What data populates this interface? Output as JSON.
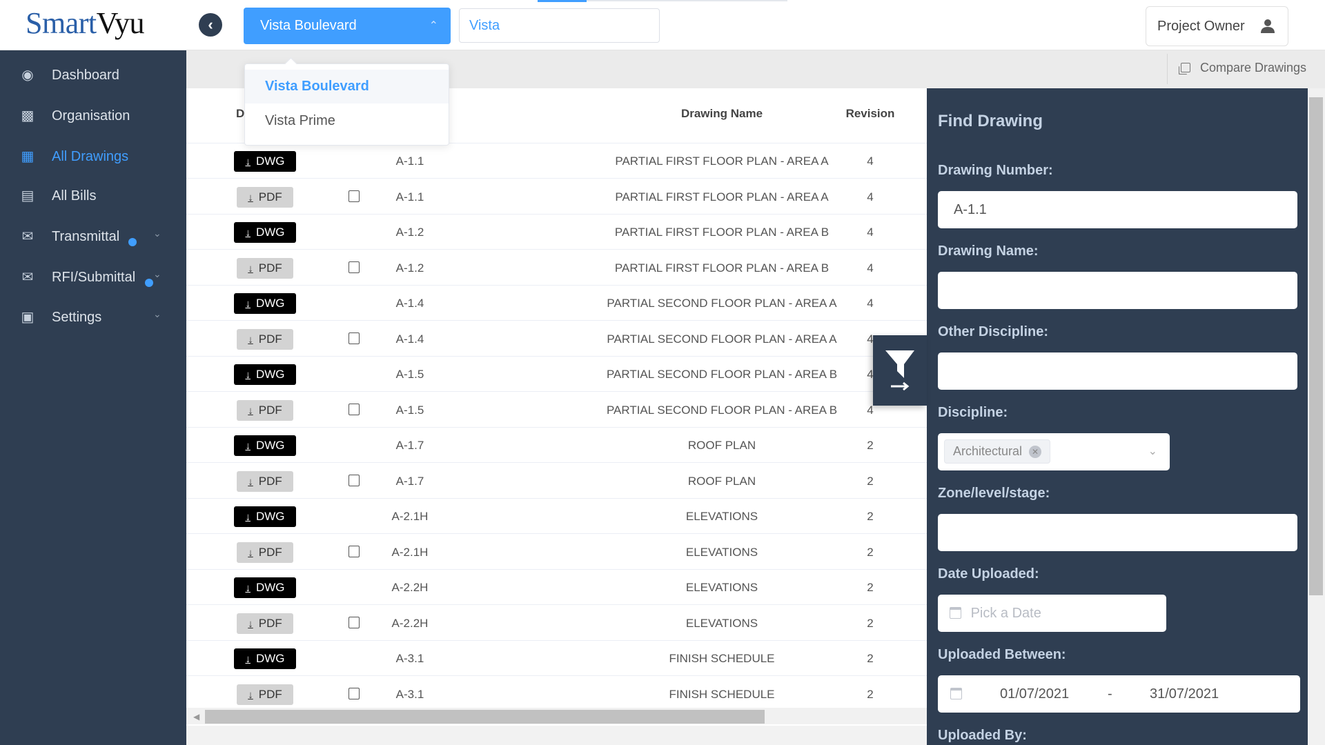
{
  "header": {
    "logo": {
      "part1": "Smart",
      "part2": "Vyu"
    },
    "project_select": {
      "value": "Vista Boulevard",
      "options": [
        "Vista Boulevard",
        "Vista Prime"
      ]
    },
    "search_value": "Vista",
    "user_label": "Project Owner"
  },
  "sidebar": {
    "items": [
      {
        "label": "Dashboard",
        "icon": "dashboard-icon"
      },
      {
        "label": "Organisation",
        "icon": "org-chart-icon"
      },
      {
        "label": "All Drawings",
        "icon": "grid-icon",
        "active": true
      },
      {
        "label": "All Bills",
        "icon": "document-icon"
      },
      {
        "label": "Transmittal",
        "icon": "mail-icon",
        "badge": true,
        "expandable": true
      },
      {
        "label": "RFI/Submittal",
        "icon": "mail-icon",
        "badge": true,
        "expandable": true
      },
      {
        "label": "Settings",
        "icon": "apps-icon",
        "expandable": true
      }
    ]
  },
  "toolbar": {
    "compare_label": "Compare Drawings"
  },
  "table": {
    "headers": {
      "download": "D",
      "name": "Drawing Name",
      "revision": "Revision"
    },
    "rows": [
      {
        "type": "DWG",
        "number": "A-1.1",
        "name": "PARTIAL FIRST FLOOR PLAN - AREA A",
        "revision": "4"
      },
      {
        "type": "PDF",
        "number": "A-1.1",
        "name": "PARTIAL FIRST FLOOR PLAN - AREA A",
        "revision": "4"
      },
      {
        "type": "DWG",
        "number": "A-1.2",
        "name": "PARTIAL FIRST FLOOR PLAN - AREA B",
        "revision": "4"
      },
      {
        "type": "PDF",
        "number": "A-1.2",
        "name": "PARTIAL FIRST FLOOR PLAN - AREA B",
        "revision": "4"
      },
      {
        "type": "DWG",
        "number": "A-1.4",
        "name": "PARTIAL SECOND FLOOR PLAN - AREA A",
        "revision": "4"
      },
      {
        "type": "PDF",
        "number": "A-1.4",
        "name": "PARTIAL SECOND FLOOR PLAN - AREA A",
        "revision": "4"
      },
      {
        "type": "DWG",
        "number": "A-1.5",
        "name": "PARTIAL SECOND FLOOR PLAN - AREA B",
        "revision": "4"
      },
      {
        "type": "PDF",
        "number": "A-1.5",
        "name": "PARTIAL SECOND FLOOR PLAN - AREA B",
        "revision": "4"
      },
      {
        "type": "DWG",
        "number": "A-1.7",
        "name": "ROOF PLAN",
        "revision": "2"
      },
      {
        "type": "PDF",
        "number": "A-1.7",
        "name": "ROOF PLAN",
        "revision": "2"
      },
      {
        "type": "DWG",
        "number": "A-2.1H",
        "name": "ELEVATIONS",
        "revision": "2"
      },
      {
        "type": "PDF",
        "number": "A-2.1H",
        "name": "ELEVATIONS",
        "revision": "2"
      },
      {
        "type": "DWG",
        "number": "A-2.2H",
        "name": "ELEVATIONS",
        "revision": "2"
      },
      {
        "type": "PDF",
        "number": "A-2.2H",
        "name": "ELEVATIONS",
        "revision": "2"
      },
      {
        "type": "DWG",
        "number": "A-3.1",
        "name": "FINISH SCHEDULE",
        "revision": "2"
      },
      {
        "type": "PDF",
        "number": "A-3.1",
        "name": "FINISH SCHEDULE",
        "revision": "2"
      }
    ]
  },
  "filter": {
    "title": "Find Drawing",
    "drawing_number_label": "Drawing Number:",
    "drawing_number_value": "A-1.1",
    "drawing_name_label": "Drawing Name:",
    "drawing_name_value": "",
    "other_discipline_label": "Other Discipline:",
    "other_discipline_value": "",
    "discipline_label": "Discipline:",
    "discipline_tag": "Architectural",
    "zone_label": "Zone/level/stage:",
    "zone_value": "",
    "date_uploaded_label": "Date Uploaded:",
    "date_placeholder": "Pick a Date",
    "uploaded_between_label": "Uploaded Between:",
    "date_from": "01/07/2021",
    "date_separator": "-",
    "date_to": "31/07/2021",
    "uploaded_by_label": "Uploaded By:"
  },
  "colors": {
    "accent": "#409eff",
    "sidebar": "#2f3e52",
    "dwg_button": "#000000",
    "pdf_button": "#d3d3d3"
  }
}
